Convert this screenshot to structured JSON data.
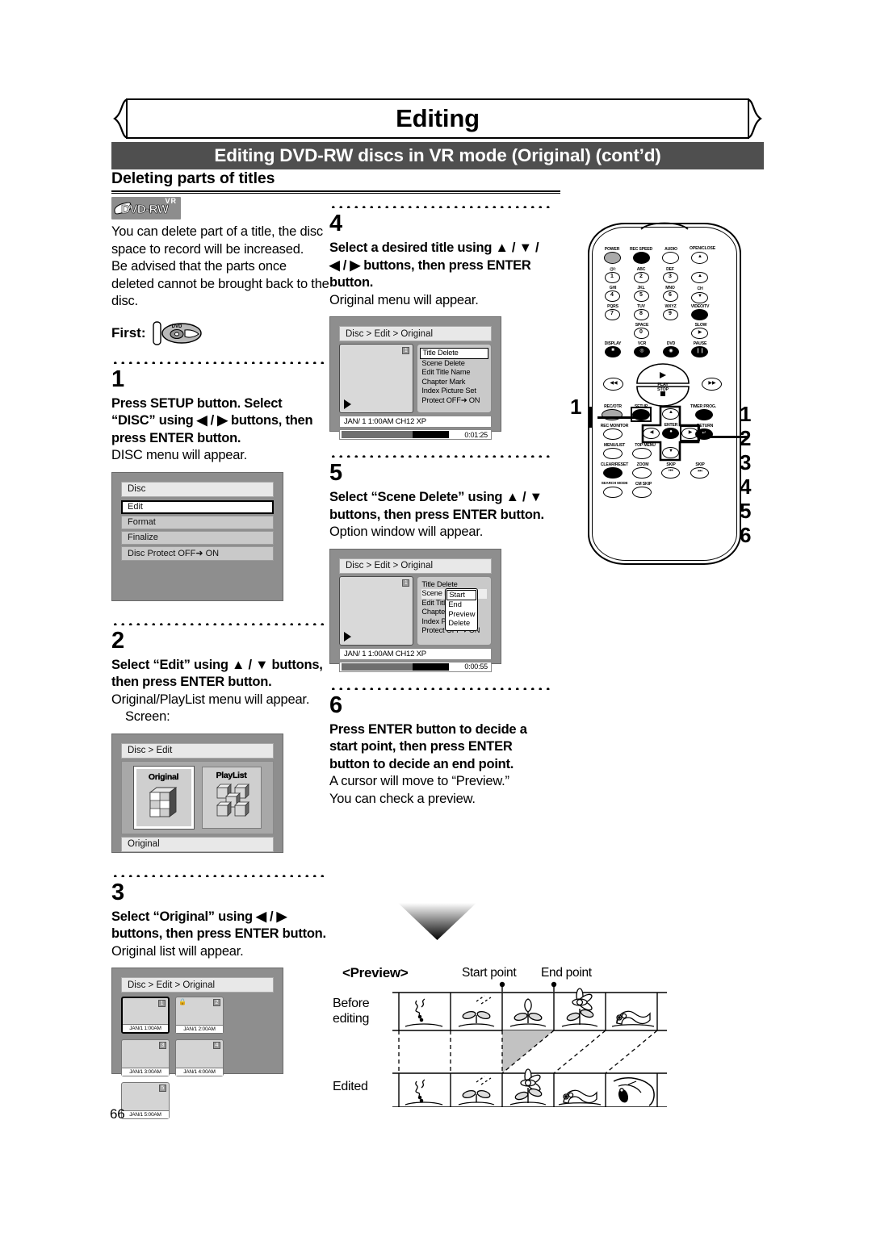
{
  "header": {
    "banner_title": "Editing",
    "subbar_title": "Editing DVD-RW discs in VR mode (Original) (cont’d)",
    "section_title": "Deleting parts of titles"
  },
  "page_number": "66",
  "intro": {
    "logo_vr": "VR",
    "logo_dvdrw": "DVD-RW",
    "paragraph1": "You can delete part of a title, the disc space to record will be increased.",
    "paragraph2": "Be advised that the parts once deleted cannot be brought back to the disc.",
    "first_label": "First:",
    "first_icon": "dvd-disc-icon"
  },
  "steps": [
    {
      "number": "1",
      "bold": "Press SETUP button. Select “DISC” using ◀ / ▶ buttons, then press ENTER button.",
      "note": "DISC menu will appear."
    },
    {
      "number": "2",
      "bold": "Select “Edit” using ▲ / ▼ buttons, then press ENTER button.",
      "note": "Original/PlayList menu will appear.",
      "note2": "Screen:"
    },
    {
      "number": "3",
      "bold": "Select “Original” using ◀ / ▶ buttons, then press ENTER button.",
      "note": "Original list will appear."
    },
    {
      "number": "4",
      "bold": "Select a desired title using ▲ / ▼ / ◀ / ▶ buttons, then press ENTER button.",
      "note": "Original menu will appear."
    },
    {
      "number": "5",
      "bold": "Select “Scene Delete” using ▲ / ▼ buttons, then press ENTER button.",
      "note": "Option window will appear."
    },
    {
      "number": "6",
      "bold": "Press ENTER button to decide a start point, then press ENTER button to decide an end point.",
      "note": "A cursor will move to “Preview.”",
      "note2": "You can check a preview."
    }
  ],
  "screen1": {
    "title": "Disc",
    "rows": [
      "Edit",
      "Format",
      "Finalize",
      "Disc Protect OFF➜ ON"
    ],
    "selected_index": 0
  },
  "screen2": {
    "title": "Disc > Edit",
    "tiles": [
      "Original",
      "PlayList"
    ],
    "selected_tile": 0,
    "footer": "Original"
  },
  "screen3": {
    "title": "Disc > Edit > Original",
    "thumbs": [
      {
        "num": "1",
        "caption": "JAN/1  1:00AM",
        "locked": false,
        "selected": true
      },
      {
        "num": "2",
        "caption": "JAN/1  2:00AM",
        "locked": true,
        "selected": false
      },
      {
        "num": "3",
        "caption": "JAN/1  3:00AM",
        "locked": false,
        "selected": false
      },
      {
        "num": "4",
        "caption": "JAN/1  4:00AM",
        "locked": false,
        "selected": false
      },
      {
        "num": "5",
        "caption": "JAN/1  5:00AM",
        "locked": false,
        "selected": false
      }
    ]
  },
  "screen4": {
    "title": "Disc > Edit > Original",
    "thumb_num": "1",
    "menu": [
      "Title Delete",
      "Scene Delete",
      "Edit Title Name",
      "Chapter Mark",
      "Index Picture Set",
      "Protect OFF➜ ON"
    ],
    "selected_index": 0,
    "info": "JAN/ 1   1:00AM  CH12      XP",
    "time": "0:01:25"
  },
  "screen5": {
    "title": "Disc > Edit > Original",
    "thumb_num": "1",
    "menu": [
      "Title Delete",
      "Scene Delete",
      "Edit Title Name",
      "Chapter Mark",
      "Index Picture Set",
      "Protect OFF➜ ON"
    ],
    "highlight_index": 1,
    "popup": [
      "Start",
      "End",
      "Preview",
      "Delete"
    ],
    "popup_selected": 0,
    "info": "JAN/ 1   1:00AM  CH12      XP",
    "time": "0:00:55"
  },
  "remote": {
    "labels": {
      "power": "POWER",
      "rec_speed": "REC SPEED",
      "audio": "AUDIO",
      "open_close": "OPEN/CLOSE",
      "k1": "@/:",
      "k2": "ABC",
      "k3": "DEF",
      "k4": "GHI",
      "k5": "JKL",
      "k6": "MNO",
      "k7": "PQRS",
      "k8": "TUV",
      "k9": "WXYZ",
      "k0": "SPACE",
      "ch": "CH",
      "video_tv": "VIDEO/TV",
      "slow": "SLOW",
      "display": "DISPLAY",
      "vcr": "VCR",
      "dvd": "DVD",
      "pause": "PAUSE",
      "play": "PLAY",
      "stop": "STOP",
      "rec_otr": "REC/OTR",
      "setup": "SETUP",
      "timer_prog": "TIMER PROG.",
      "rec_monitor": "REC MONITOR",
      "enter": "ENTER",
      "menu_list": "MENU/LIST",
      "top_menu": "TOP MENU",
      "return": "RETURN",
      "clear_reset": "CLEAR/RESET",
      "zoom": "ZOOM",
      "skip_prev": "SKIP",
      "skip_next": "SKIP",
      "search_mode": "SEARCH MODE",
      "cm_skip": "CM SKIP"
    },
    "numbers": [
      "1",
      "2",
      "3",
      "4",
      "5",
      "6",
      "7",
      "8",
      "9",
      "0"
    ],
    "callout_left": "1",
    "callouts_right": [
      "1",
      "2",
      "3",
      "4",
      "5",
      "6"
    ]
  },
  "preview_diagram": {
    "title": "<Preview>",
    "start_point_label": "Start point",
    "end_point_label": "End point",
    "row1_label_line1": "Before",
    "row1_label_line2": "editing",
    "row2_label": "Edited",
    "before_frames": [
      "seed-sprouting-icon",
      "sprout-icon",
      "bud-icon",
      "flower-icon",
      "worm-icon"
    ],
    "edited_frames": [
      "seed-sprouting-icon",
      "sprout-icon",
      "flower-icon",
      "worm-icon",
      "bird-icon"
    ],
    "deleted_region": "frame-3-before-editing"
  }
}
